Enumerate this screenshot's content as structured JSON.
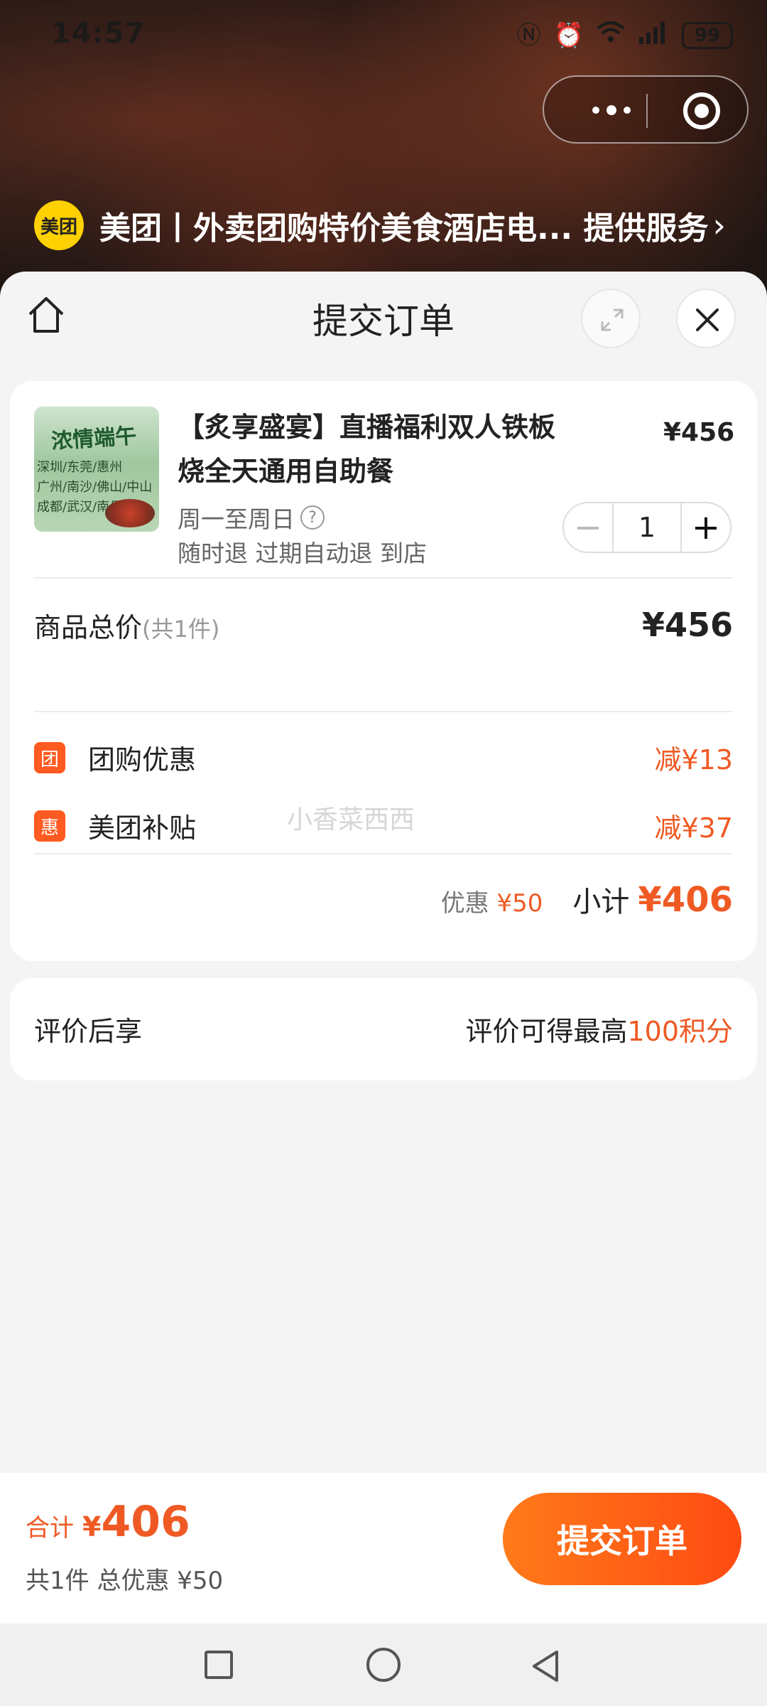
{
  "status_bar": {
    "time": "14:57",
    "battery": "99"
  },
  "provider": {
    "logo_text": "美团",
    "text": "美团丨外卖团购特价美食酒店电... 提供服务"
  },
  "sheet": {
    "title": "提交订单"
  },
  "product": {
    "image_title": "浓情端午",
    "image_lines": [
      "深圳/东莞/惠州",
      "广州/南沙/佛山/中山",
      "成都/武汉/南昌"
    ],
    "name": "【炙享盛宴】直播福利双人铁板烧全天通用自助餐",
    "price": "¥456",
    "schedule": "周一至周日",
    "policy": "随时退 过期自动退 到店",
    "quantity": "1"
  },
  "summary": {
    "total_label": "商品总价",
    "total_count": "(共1件)",
    "total_value": "¥456",
    "discounts": [
      {
        "badge": "团",
        "label": "团购优惠",
        "value": "减¥13"
      },
      {
        "badge": "惠",
        "label": "美团补贴",
        "value": "减¥37"
      }
    ],
    "watermark": "小香菜西西",
    "discount_label": "优惠",
    "discount_value": "¥50",
    "subtotal_label": "小计",
    "subtotal_value": "¥406"
  },
  "review": {
    "label": "评价后享",
    "text": "评价可得最高",
    "highlight": "100积分"
  },
  "bottom": {
    "sum_label": "合计",
    "sum_currency": "¥",
    "sum_value": "406",
    "meta": "共1件 总优惠 ¥50",
    "submit_label": "提交订单"
  },
  "colors": {
    "accent": "#ef5a24",
    "brand_yellow": "#ffd100",
    "button_start": "#ff7a1a",
    "button_end": "#ff4b12"
  }
}
